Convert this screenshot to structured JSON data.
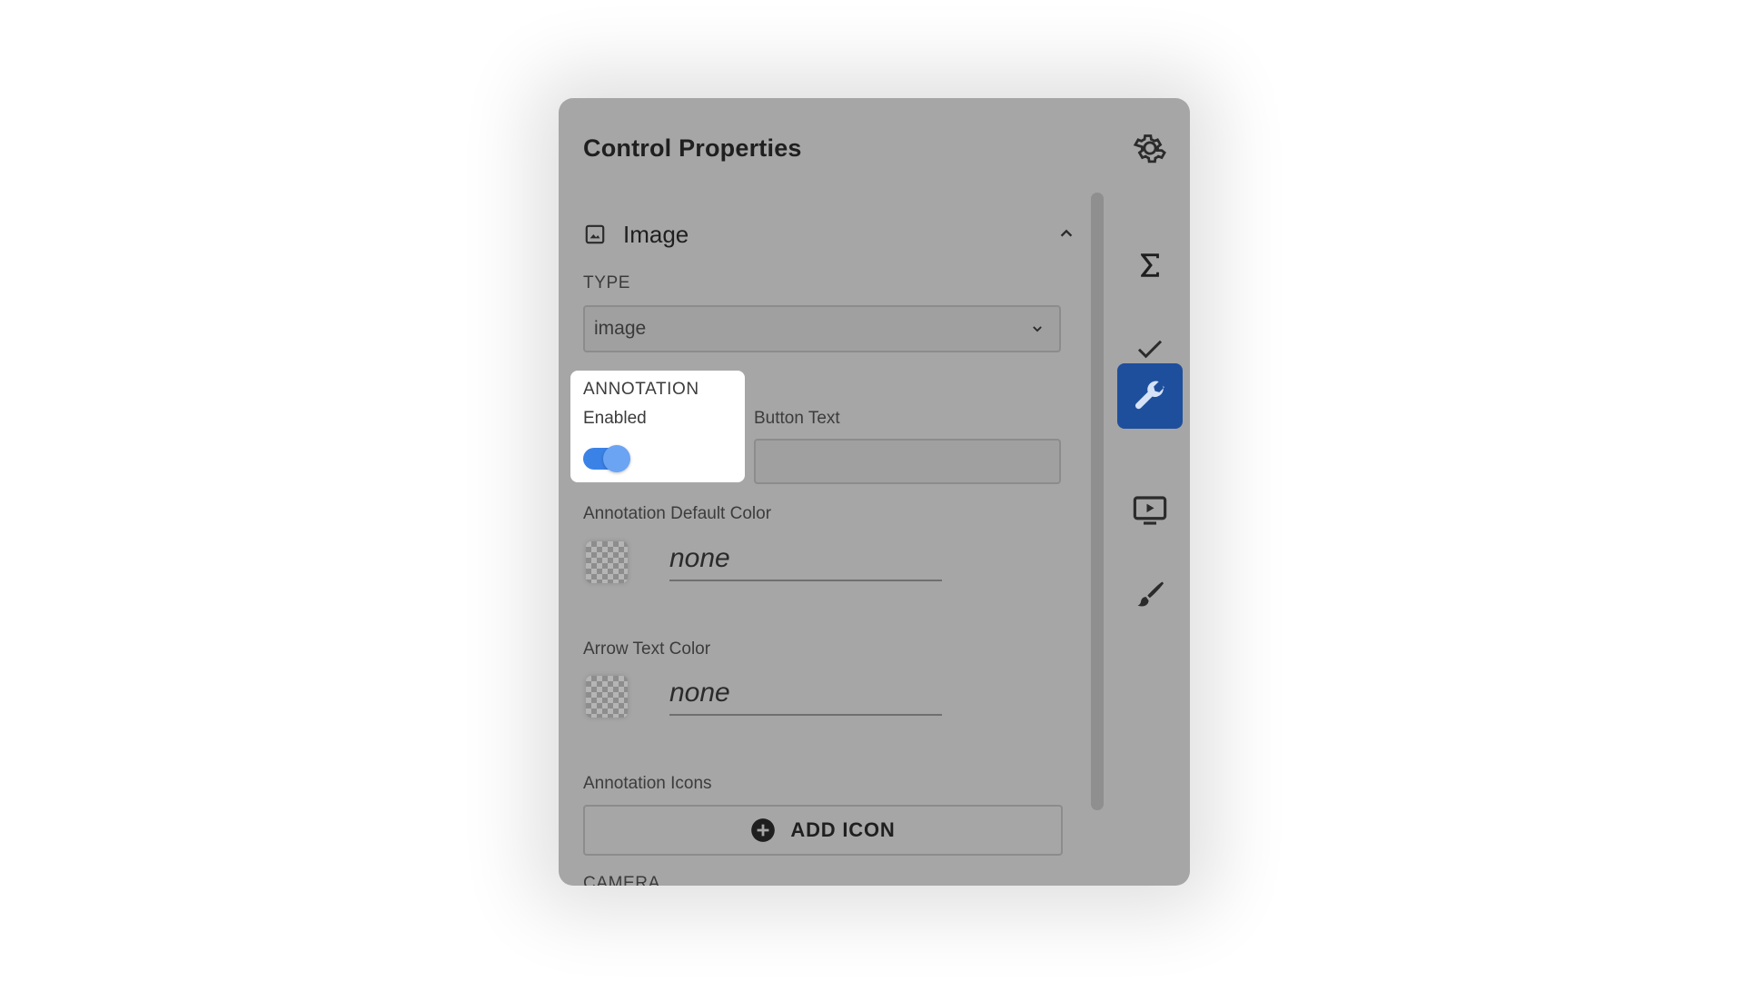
{
  "panel": {
    "title": "Control Properties"
  },
  "section": {
    "label": "Image"
  },
  "type_field": {
    "label": "TYPE",
    "value": "image"
  },
  "annotation": {
    "title": "ANNOTATION",
    "enabled_label": "Enabled",
    "enabled": true
  },
  "button_text": {
    "label": "Button Text",
    "value": ""
  },
  "annotation_default_color": {
    "label": "Annotation Default Color",
    "value": "none"
  },
  "arrow_text_color": {
    "label": "Arrow Text Color",
    "value": "none"
  },
  "annotation_icons": {
    "label": "Annotation Icons",
    "add_label": "ADD ICON"
  },
  "camera": {
    "label": "CAMERA"
  },
  "rail": {
    "items": [
      "sigma-icon",
      "check-icon",
      "wrench-icon",
      "play-screen-icon",
      "brush-icon"
    ],
    "active": "wrench-icon"
  },
  "colors": {
    "panel_bg": "#a6a6a6",
    "active_rail": "#1e4f9c",
    "toggle_on": "#3b82e6"
  }
}
